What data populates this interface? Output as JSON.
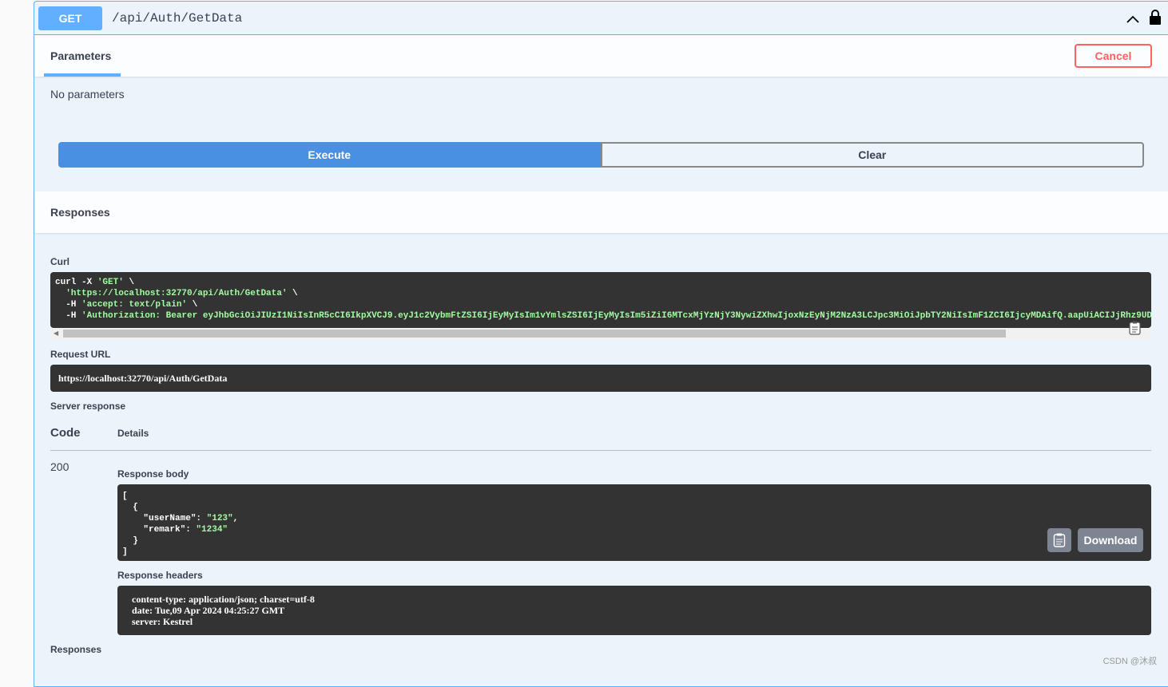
{
  "operation": {
    "method": "GET",
    "path": "/api/Auth/GetData"
  },
  "parameters": {
    "tab_label": "Parameters",
    "cancel_label": "Cancel",
    "empty_text": "No parameters"
  },
  "actions": {
    "execute_label": "Execute",
    "clear_label": "Clear"
  },
  "responses": {
    "header": "Responses",
    "curl_label": "Curl",
    "curl_lines": {
      "l1_cmd": "curl -X ",
      "l1_method": "'GET'",
      "l1_tail": " \\",
      "l2_url": "'https://localhost:32770/api/Auth/GetData'",
      "l2_tail": " \\",
      "l3_flag": "  -H ",
      "l3_val": "'accept: text/plain'",
      "l3_tail": " \\",
      "l4_flag": "  -H ",
      "l4_val": "'Authorization: Bearer eyJhbGciOiJIUzI1NiIsInR5cCI6IkpXVCJ9.eyJ1c2VybmFtZSI6IjEyMyIsIm1vYmlsZSI6IjEyMyIsIm5iZiI6MTcxMjYzNjY3NywiZXhwIjoxNzEyNjM2NzA3LCJpc3MiOiJpbTY2NiIsImF1ZCI6IjcyMDAifQ.aapUiACIJjRhz9UD"
    },
    "request_url_label": "Request URL",
    "request_url": "https://localhost:32770/api/Auth/GetData",
    "server_response_label": "Server response",
    "col_code": "Code",
    "col_details": "Details",
    "status_code": "200",
    "body_label": "Response body",
    "body": {
      "open_bracket": "[",
      "open_brace": "  {",
      "k1": "    \"userName\"",
      "v1": "\"123\"",
      "k2": "    \"remark\"",
      "v2": "\"1234\"",
      "close_brace": "  }",
      "close_bracket": "]"
    },
    "download_label": "Download",
    "headers_label": "Response headers",
    "headers": [
      "content-type: application/json; charset=utf-8",
      "date: Tue,09 Apr 2024 04:25:27 GMT",
      "server: Kestrel"
    ],
    "footer_label": "Responses"
  },
  "watermark": "CSDN @沐叔",
  "colors": {
    "get_blue": "#61affe",
    "execute_blue": "#4990e2",
    "cancel_red": "#ff6060",
    "code_bg": "#333333",
    "string_green": "#a2fca2"
  },
  "icons": [
    "chevron-up-icon",
    "lock-icon",
    "copy-icon"
  ]
}
